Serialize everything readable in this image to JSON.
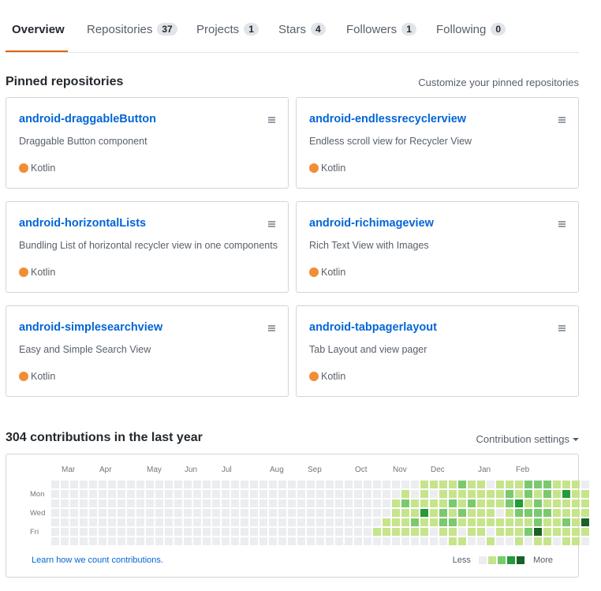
{
  "tabs": [
    {
      "label": "Overview",
      "count": null,
      "selected": true
    },
    {
      "label": "Repositories",
      "count": "37"
    },
    {
      "label": "Projects",
      "count": "1"
    },
    {
      "label": "Stars",
      "count": "4"
    },
    {
      "label": "Followers",
      "count": "1"
    },
    {
      "label": "Following",
      "count": "0"
    }
  ],
  "pinned": {
    "title": "Pinned repositories",
    "customize_label": "Customize your pinned repositories",
    "repos": [
      {
        "name": "android-draggableButton",
        "description": "Draggable Button component",
        "language": "Kotlin"
      },
      {
        "name": "android-endlessrecyclerview",
        "description": "Endless scroll view for Recycler View",
        "language": "Kotlin"
      },
      {
        "name": "android-horizontalLists",
        "description": "Bundling List of horizontal recycler view in one components",
        "language": "Kotlin"
      },
      {
        "name": "android-richimageview",
        "description": "Rich Text View with Images",
        "language": "Kotlin"
      },
      {
        "name": "android-simplesearchview",
        "description": "Easy and Simple Search View",
        "language": "Kotlin"
      },
      {
        "name": "android-tabpagerlayout",
        "description": "Tab Layout and view pager",
        "language": "Kotlin"
      }
    ]
  },
  "language_color": "#f18e33",
  "contributions": {
    "title": "304 contributions in the last year",
    "settings_label": "Contribution settings",
    "months": [
      "Mar",
      "Apr",
      "May",
      "Jun",
      "Jul",
      "Aug",
      "Sep",
      "Oct",
      "Nov",
      "Dec",
      "Jan",
      "Feb"
    ],
    "day_labels": [
      "Mon",
      "Wed",
      "Fri"
    ],
    "learn_label": "Learn how we count contributions.",
    "legend_less": "Less",
    "legend_more": "More",
    "level_colors": [
      "#ebedf0",
      "#c6e48b",
      "#7bc96f",
      "#239a3b",
      "#196127"
    ],
    "weeks": [
      [
        0,
        0,
        0,
        0,
        0,
        0,
        0
      ],
      [
        0,
        0,
        0,
        0,
        0,
        0,
        0
      ],
      [
        0,
        0,
        0,
        0,
        0,
        0,
        0
      ],
      [
        0,
        0,
        0,
        0,
        0,
        0,
        0
      ],
      [
        0,
        0,
        0,
        0,
        0,
        0,
        0
      ],
      [
        0,
        0,
        0,
        0,
        0,
        0,
        0
      ],
      [
        0,
        0,
        0,
        0,
        0,
        0,
        0
      ],
      [
        0,
        0,
        0,
        0,
        0,
        0,
        0
      ],
      [
        0,
        0,
        0,
        0,
        0,
        0,
        0
      ],
      [
        0,
        0,
        0,
        0,
        0,
        0,
        0
      ],
      [
        0,
        0,
        0,
        0,
        0,
        0,
        0
      ],
      [
        0,
        0,
        0,
        0,
        0,
        0,
        0
      ],
      [
        0,
        0,
        0,
        0,
        0,
        0,
        0
      ],
      [
        0,
        0,
        0,
        0,
        0,
        0,
        0
      ],
      [
        0,
        0,
        0,
        0,
        0,
        0,
        0
      ],
      [
        0,
        0,
        0,
        0,
        0,
        0,
        0
      ],
      [
        0,
        0,
        0,
        0,
        0,
        0,
        0
      ],
      [
        0,
        0,
        0,
        0,
        0,
        0,
        0
      ],
      [
        0,
        0,
        0,
        0,
        0,
        0,
        0
      ],
      [
        0,
        0,
        0,
        0,
        0,
        0,
        0
      ],
      [
        0,
        0,
        0,
        0,
        0,
        0,
        0
      ],
      [
        0,
        0,
        0,
        0,
        0,
        0,
        0
      ],
      [
        0,
        0,
        0,
        0,
        0,
        0,
        0
      ],
      [
        0,
        0,
        0,
        0,
        0,
        0,
        0
      ],
      [
        0,
        0,
        0,
        0,
        0,
        0,
        0
      ],
      [
        0,
        0,
        0,
        0,
        0,
        0,
        0
      ],
      [
        0,
        0,
        0,
        0,
        0,
        0,
        0
      ],
      [
        0,
        0,
        0,
        0,
        0,
        0,
        0
      ],
      [
        0,
        0,
        0,
        0,
        0,
        0,
        0
      ],
      [
        0,
        0,
        0,
        0,
        0,
        0,
        0
      ],
      [
        0,
        0,
        0,
        0,
        0,
        0,
        0
      ],
      [
        0,
        0,
        0,
        0,
        0,
        0,
        0
      ],
      [
        0,
        0,
        0,
        0,
        0,
        0,
        0
      ],
      [
        0,
        0,
        0,
        0,
        0,
        0,
        0
      ],
      [
        0,
        0,
        0,
        0,
        0,
        1,
        0
      ],
      [
        0,
        0,
        0,
        0,
        1,
        1,
        0
      ],
      [
        0,
        0,
        1,
        1,
        1,
        1,
        0
      ],
      [
        0,
        1,
        2,
        1,
        1,
        1,
        0
      ],
      [
        0,
        0,
        1,
        1,
        2,
        1,
        0
      ],
      [
        1,
        1,
        1,
        3,
        1,
        1,
        0
      ],
      [
        1,
        0,
        1,
        1,
        1,
        0,
        0
      ],
      [
        1,
        1,
        1,
        2,
        2,
        1,
        0
      ],
      [
        1,
        1,
        2,
        1,
        2,
        1,
        1
      ],
      [
        2,
        1,
        1,
        2,
        1,
        0,
        1
      ],
      [
        1,
        1,
        2,
        1,
        1,
        1,
        0
      ],
      [
        1,
        1,
        1,
        1,
        1,
        1,
        0
      ],
      [
        0,
        1,
        1,
        1,
        1,
        0,
        1
      ],
      [
        1,
        1,
        1,
        0,
        1,
        1,
        0
      ],
      [
        1,
        2,
        2,
        1,
        1,
        1,
        0
      ],
      [
        1,
        1,
        3,
        2,
        1,
        1,
        1
      ],
      [
        2,
        2,
        1,
        2,
        1,
        2,
        0
      ],
      [
        2,
        1,
        2,
        2,
        2,
        4,
        1
      ],
      [
        2,
        2,
        1,
        2,
        1,
        1,
        1
      ],
      [
        1,
        1,
        1,
        1,
        1,
        1,
        0
      ],
      [
        1,
        3,
        1,
        1,
        2,
        1,
        1
      ],
      [
        1,
        1,
        1,
        1,
        1,
        1,
        1
      ],
      [
        0,
        1,
        1,
        1,
        4,
        1,
        0
      ]
    ]
  }
}
